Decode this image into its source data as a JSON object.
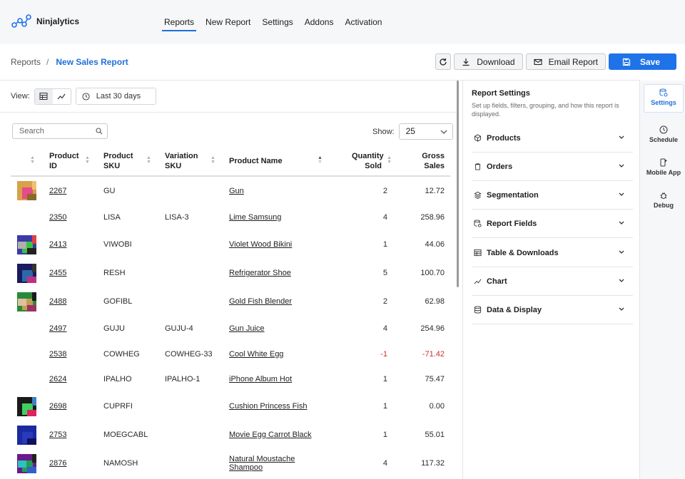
{
  "app": {
    "name": "Ninjalytics",
    "accent": "#1e73e8"
  },
  "nav": {
    "tabs": [
      {
        "label": "Reports",
        "active": true
      },
      {
        "label": "New Report"
      },
      {
        "label": "Settings"
      },
      {
        "label": "Addons"
      },
      {
        "label": "Activation"
      }
    ]
  },
  "breadcrumb": {
    "parent": "Reports",
    "separator": "/",
    "current": "New Sales Report"
  },
  "toolbar": {
    "download": "Download",
    "email": "Email Report",
    "save": "Save"
  },
  "view": {
    "label": "View:",
    "date_range": "Last 30 days"
  },
  "search": {
    "placeholder": "Search"
  },
  "show": {
    "label": "Show:",
    "value": "25"
  },
  "table": {
    "headers": [
      "Product ID",
      "Product SKU",
      "Variation SKU",
      "Product Name",
      "Quantity Sold",
      "Gross Sales"
    ],
    "rows": [
      {
        "id": "2267",
        "sku": "GU",
        "vsku": "",
        "name": "Gun",
        "qty": "2",
        "gross": "12.72",
        "thumb": true
      },
      {
        "id": "2350",
        "sku": "LISA",
        "vsku": "LISA-3",
        "name": "Lime Samsung",
        "qty": "4",
        "gross": "258.96",
        "thumb": false
      },
      {
        "id": "2413",
        "sku": "VIWOBI",
        "vsku": "",
        "name": "Violet Wood Bikini",
        "qty": "1",
        "gross": "44.06",
        "thumb": true
      },
      {
        "id": "2455",
        "sku": "RESH",
        "vsku": "",
        "name": "Refrigerator Shoe",
        "qty": "5",
        "gross": "100.70",
        "thumb": true
      },
      {
        "id": "2488",
        "sku": "GOFIBL",
        "vsku": "",
        "name": "Gold Fish Blender",
        "qty": "2",
        "gross": "62.98",
        "thumb": true
      },
      {
        "id": "2497",
        "sku": "GUJU",
        "vsku": "GUJU-4",
        "name": "Gun Juice",
        "qty": "4",
        "gross": "254.96",
        "thumb": false
      },
      {
        "id": "2538",
        "sku": "COWHEG",
        "vsku": "COWHEG-33",
        "name": "Cool White Egg",
        "qty": "-1",
        "gross": "-71.42",
        "thumb": false,
        "negative": true
      },
      {
        "id": "2624",
        "sku": "IPALHO",
        "vsku": "IPALHO-1",
        "name": "iPhone Album Hot",
        "qty": "1",
        "gross": "75.47",
        "thumb": false
      },
      {
        "id": "2698",
        "sku": "CUPRFI",
        "vsku": "",
        "name": "Cushion Princess Fish",
        "qty": "1",
        "gross": "0.00",
        "thumb": true
      },
      {
        "id": "2753",
        "sku": "MOEGCABL",
        "vsku": "",
        "name": "Movie Egg Carrot Black",
        "qty": "1",
        "gross": "55.01",
        "thumb": true
      },
      {
        "id": "2876",
        "sku": "NAMOSH",
        "vsku": "",
        "name": "Natural Moustache Shampoo",
        "qty": "4",
        "gross": "117.32",
        "thumb": true
      }
    ]
  },
  "settings_panel": {
    "title": "Report Settings",
    "description": "Set up fields, filters, grouping, and how this report is displayed.",
    "sections": [
      "Products",
      "Orders",
      "Segmentation",
      "Report Fields",
      "Table & Downloads",
      "Chart",
      "Data & Display"
    ]
  },
  "rail": {
    "items": [
      {
        "label": "Settings",
        "active": true
      },
      {
        "label": "Schedule"
      },
      {
        "label": "Mobile App"
      },
      {
        "label": "Debug"
      }
    ]
  }
}
